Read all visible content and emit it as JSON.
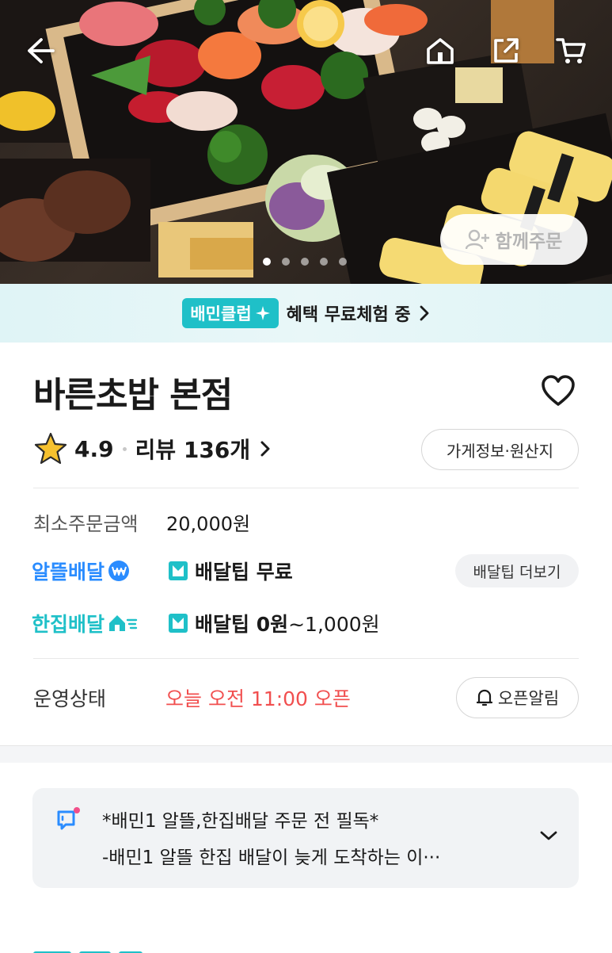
{
  "hero": {
    "together_label": "함께주문",
    "slide_count": 5,
    "active_slide": 1
  },
  "club": {
    "badge": "배민클럽",
    "text": "혜택 무료체험 중"
  },
  "store": {
    "name": "바른초밥 본점",
    "rating": "4.9",
    "review_label": "리뷰 136개",
    "info_button": "가게정보·원산지"
  },
  "order": {
    "min_label": "최소주문금액",
    "min_value": "20,000원"
  },
  "delivery": {
    "alddeul_brand": "알뜰배달",
    "alddeul_tip": "배달팁 무료",
    "more_tip_button": "배달팁 더보기",
    "hanjip_brand": "한집배달",
    "hanjip_tip_bold": "배달팁 0원",
    "hanjip_tip_rest": "~1,000원"
  },
  "status": {
    "label": "운영상태",
    "value": "오늘 오전 11:00 오픈",
    "alarm_button": "오픈알림"
  },
  "notice": {
    "line1": "*배민1 알뜰,한집배달 주문 전 필독*",
    "line2": "-배민1 알뜰 한집 배달이 늦게 도착하는 이···"
  },
  "colors": {
    "alddeul": "#2a8cff",
    "hanjip": "#1fc0c8",
    "status": "#f14f4f",
    "star": "#f6c12e"
  }
}
